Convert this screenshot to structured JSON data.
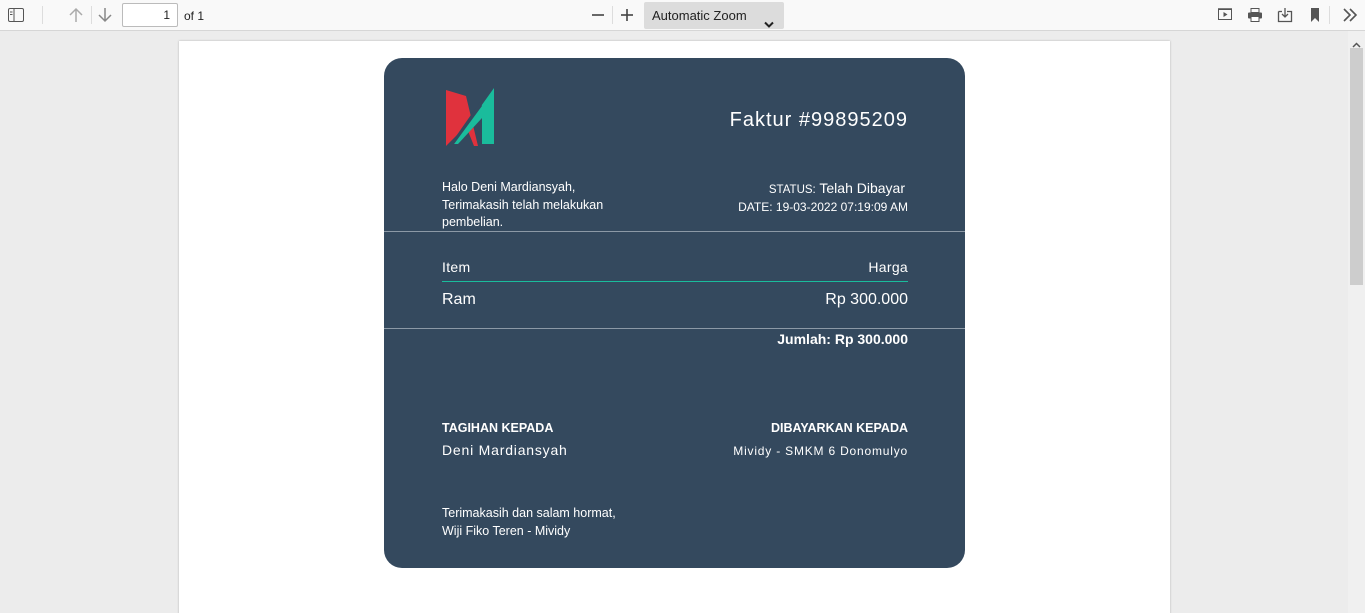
{
  "toolbar": {
    "page_number": "1",
    "page_of": "of 1",
    "zoom": "Automatic Zoom",
    "icons": [
      "sidebar-toggle-icon",
      "arrow-up-icon",
      "arrow-down-icon",
      "zoom-out-icon",
      "zoom-in-icon",
      "presentation-icon",
      "print-icon",
      "save-icon",
      "bookmark-icon",
      "tools-icon"
    ]
  },
  "invoice": {
    "title": "Faktur #99895209",
    "greeting_line1": "Halo Deni Mardiansyah,",
    "greeting_line2": "Terimakasih telah melakukan pembelian.",
    "status_label": "STATUS:",
    "status_value": "Telah Dibayar",
    "date": "DATE: 19-03-2022 07:19:09 AM",
    "item_header": "Item",
    "price_header": "Harga",
    "items": [
      {
        "name": "Ram",
        "price": "Rp 300.000"
      }
    ],
    "total": "Jumlah: Rp 300.000",
    "bill_to_heading": "TAGIHAN KEPADA",
    "bill_to_value": "Deni Mardiansyah",
    "paid_to_heading": "DIBAYARKAN KEPADA",
    "paid_to_value": "Mividy - SMKM 6 Donomulyo",
    "closing_line1": "Terimakasih dan salam hormat,",
    "closing_line2": "Wiji Fiko Teren - Mividy"
  },
  "colors": {
    "card_bg": "#34495e",
    "accent": "#1abc9c",
    "logo_red": "#e0323d",
    "logo_teal": "#1abc9c"
  }
}
